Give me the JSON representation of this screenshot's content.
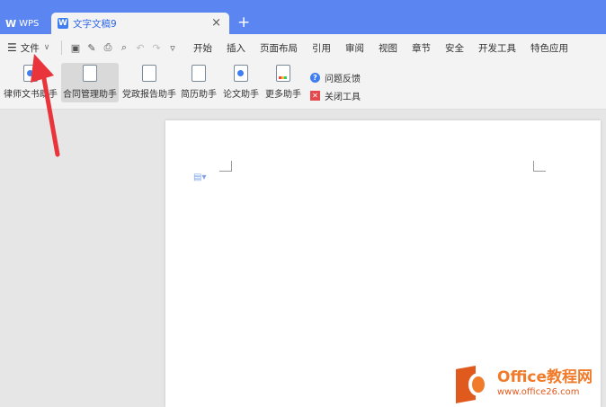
{
  "titlebar": {
    "app_label": "WPS",
    "doc_tab_label": "文字文稿9",
    "close_glyph": "×",
    "new_tab_glyph": "+"
  },
  "menubar": {
    "file_label": "文件",
    "tabs": [
      "开始",
      "插入",
      "页面布局",
      "引用",
      "审阅",
      "视图",
      "章节",
      "安全",
      "开发工具",
      "特色应用"
    ]
  },
  "ribbon": {
    "buttons": [
      {
        "label": "律师文书助手",
        "icon": "lawyer-doc-icon"
      },
      {
        "label": "合同管理助手",
        "icon": "contract-icon",
        "active": true
      },
      {
        "label": "党政报告助手",
        "icon": "report-icon"
      },
      {
        "label": "简历助手",
        "icon": "resume-icon"
      },
      {
        "label": "论文助手",
        "icon": "thesis-icon"
      },
      {
        "label": "更多助手",
        "icon": "more-icon"
      }
    ],
    "side_tools": [
      {
        "label": "问题反馈",
        "icon": "question-icon"
      },
      {
        "label": "关闭工具",
        "icon": "close-tool-icon"
      }
    ]
  },
  "watermark": {
    "line1": "Office教程网",
    "line2": "www.office26.com"
  },
  "colors": {
    "titlebar": "#5b86f2",
    "accent": "#3f7ef0",
    "arrow": "#e8343a",
    "watermark": "#f07b2b"
  }
}
